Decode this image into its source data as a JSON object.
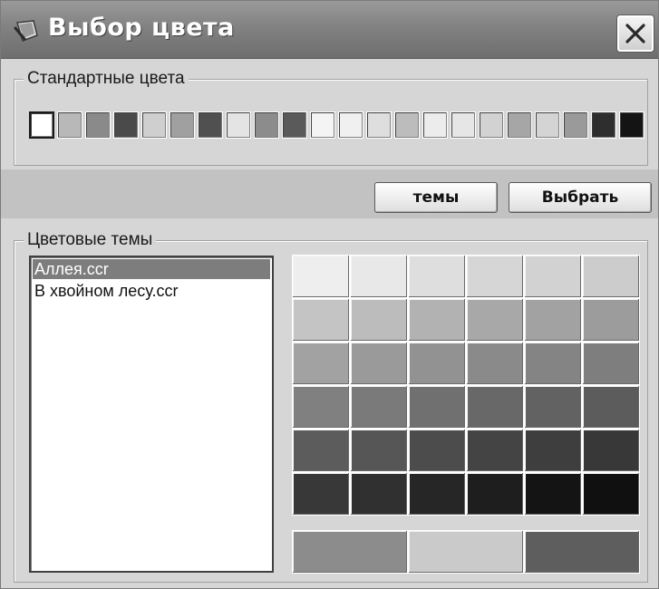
{
  "window": {
    "title": "Выбор цвета",
    "icon": "app-palette-icon",
    "close_icon": "close-icon"
  },
  "standard_colors": {
    "label": "Стандартные цвета",
    "swatches": [
      "#ffffff",
      "#b8b8b8",
      "#8a8a8a",
      "#4a4a4a",
      "#cfcfcf",
      "#a0a0a0",
      "#505050",
      "#e4e4e4",
      "#8c8c8c",
      "#5a5a5a",
      "#f4f4f4",
      "#f0f0f0",
      "#dedede",
      "#bcbcbc",
      "#ececec",
      "#e6e6e6",
      "#d2d2d2",
      "#a6a6a6",
      "#d4d4d4",
      "#9a9a9a",
      "#2e2e2e",
      "#141414"
    ],
    "selected_index": 0
  },
  "buttons": {
    "themes_label": "темы",
    "choose_label": "Выбрать"
  },
  "color_themes": {
    "label": "Цветовые темы",
    "files": [
      "Аллея.ccr",
      "В хвойном лесу.ccr"
    ],
    "selected_index": 0
  },
  "palette_grid": {
    "rows": [
      [
        "#eeeeee",
        "#e8e8e8",
        "#dedede",
        "#d6d6d6",
        "#d2d2d2",
        "#cccccc"
      ],
      [
        "#c4c4c4",
        "#bcbcbc",
        "#b2b2b2",
        "#a8a8a8",
        "#a2a2a2",
        "#9c9c9c"
      ],
      [
        "#a2a2a2",
        "#9a9a9a",
        "#929292",
        "#8a8a8a",
        "#848484",
        "#7e7e7e"
      ],
      [
        "#808080",
        "#7a7a7a",
        "#707070",
        "#686868",
        "#626262",
        "#5c5c5c"
      ],
      [
        "#5c5c5c",
        "#565656",
        "#4c4c4c",
        "#444444",
        "#3e3e3e",
        "#383838"
      ],
      [
        "#383838",
        "#303030",
        "#262626",
        "#1e1e1e",
        "#141414",
        "#101010"
      ]
    ],
    "strip": [
      "#8c8c8c",
      "#cacaca",
      "#5e5e5e"
    ]
  }
}
